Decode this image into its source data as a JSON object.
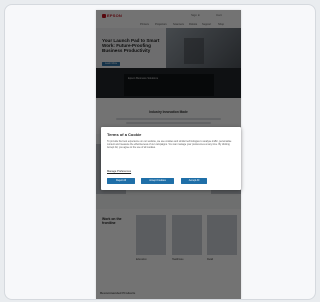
{
  "site": {
    "logo_text": "EPSON",
    "utility": [
      "Sign in",
      "Cart"
    ],
    "nav": [
      "Printers",
      "Projectors",
      "Scanners",
      "Robots",
      "Support",
      "Shop"
    ]
  },
  "hero": {
    "title": "Your Launch Pad to Smart Work: Future-Proofing Business Productivity",
    "button": "Learn More"
  },
  "dark_strip": {
    "text": "Epson Business Solutions"
  },
  "sections": {
    "middle_title": "Industry Innovation Made",
    "bottom_title": "Work on the frontline",
    "tiles": [
      "Education",
      "Healthcare",
      "Retail"
    ],
    "footer_title": "Recommended Products"
  },
  "cookie_modal": {
    "title": "Terms of a Cookie",
    "body": "To provide the best experience on our website, we use cookies and similar technologies to analyse traffic, personalise content and measure the effectiveness of our campaigns. You can manage your preferences at any time. By clicking Accept All, you agree to the use of all cookies.",
    "link": "Manage Preferences",
    "buttons": [
      "Reject All",
      "Accept Cookies",
      "Accept All"
    ]
  }
}
